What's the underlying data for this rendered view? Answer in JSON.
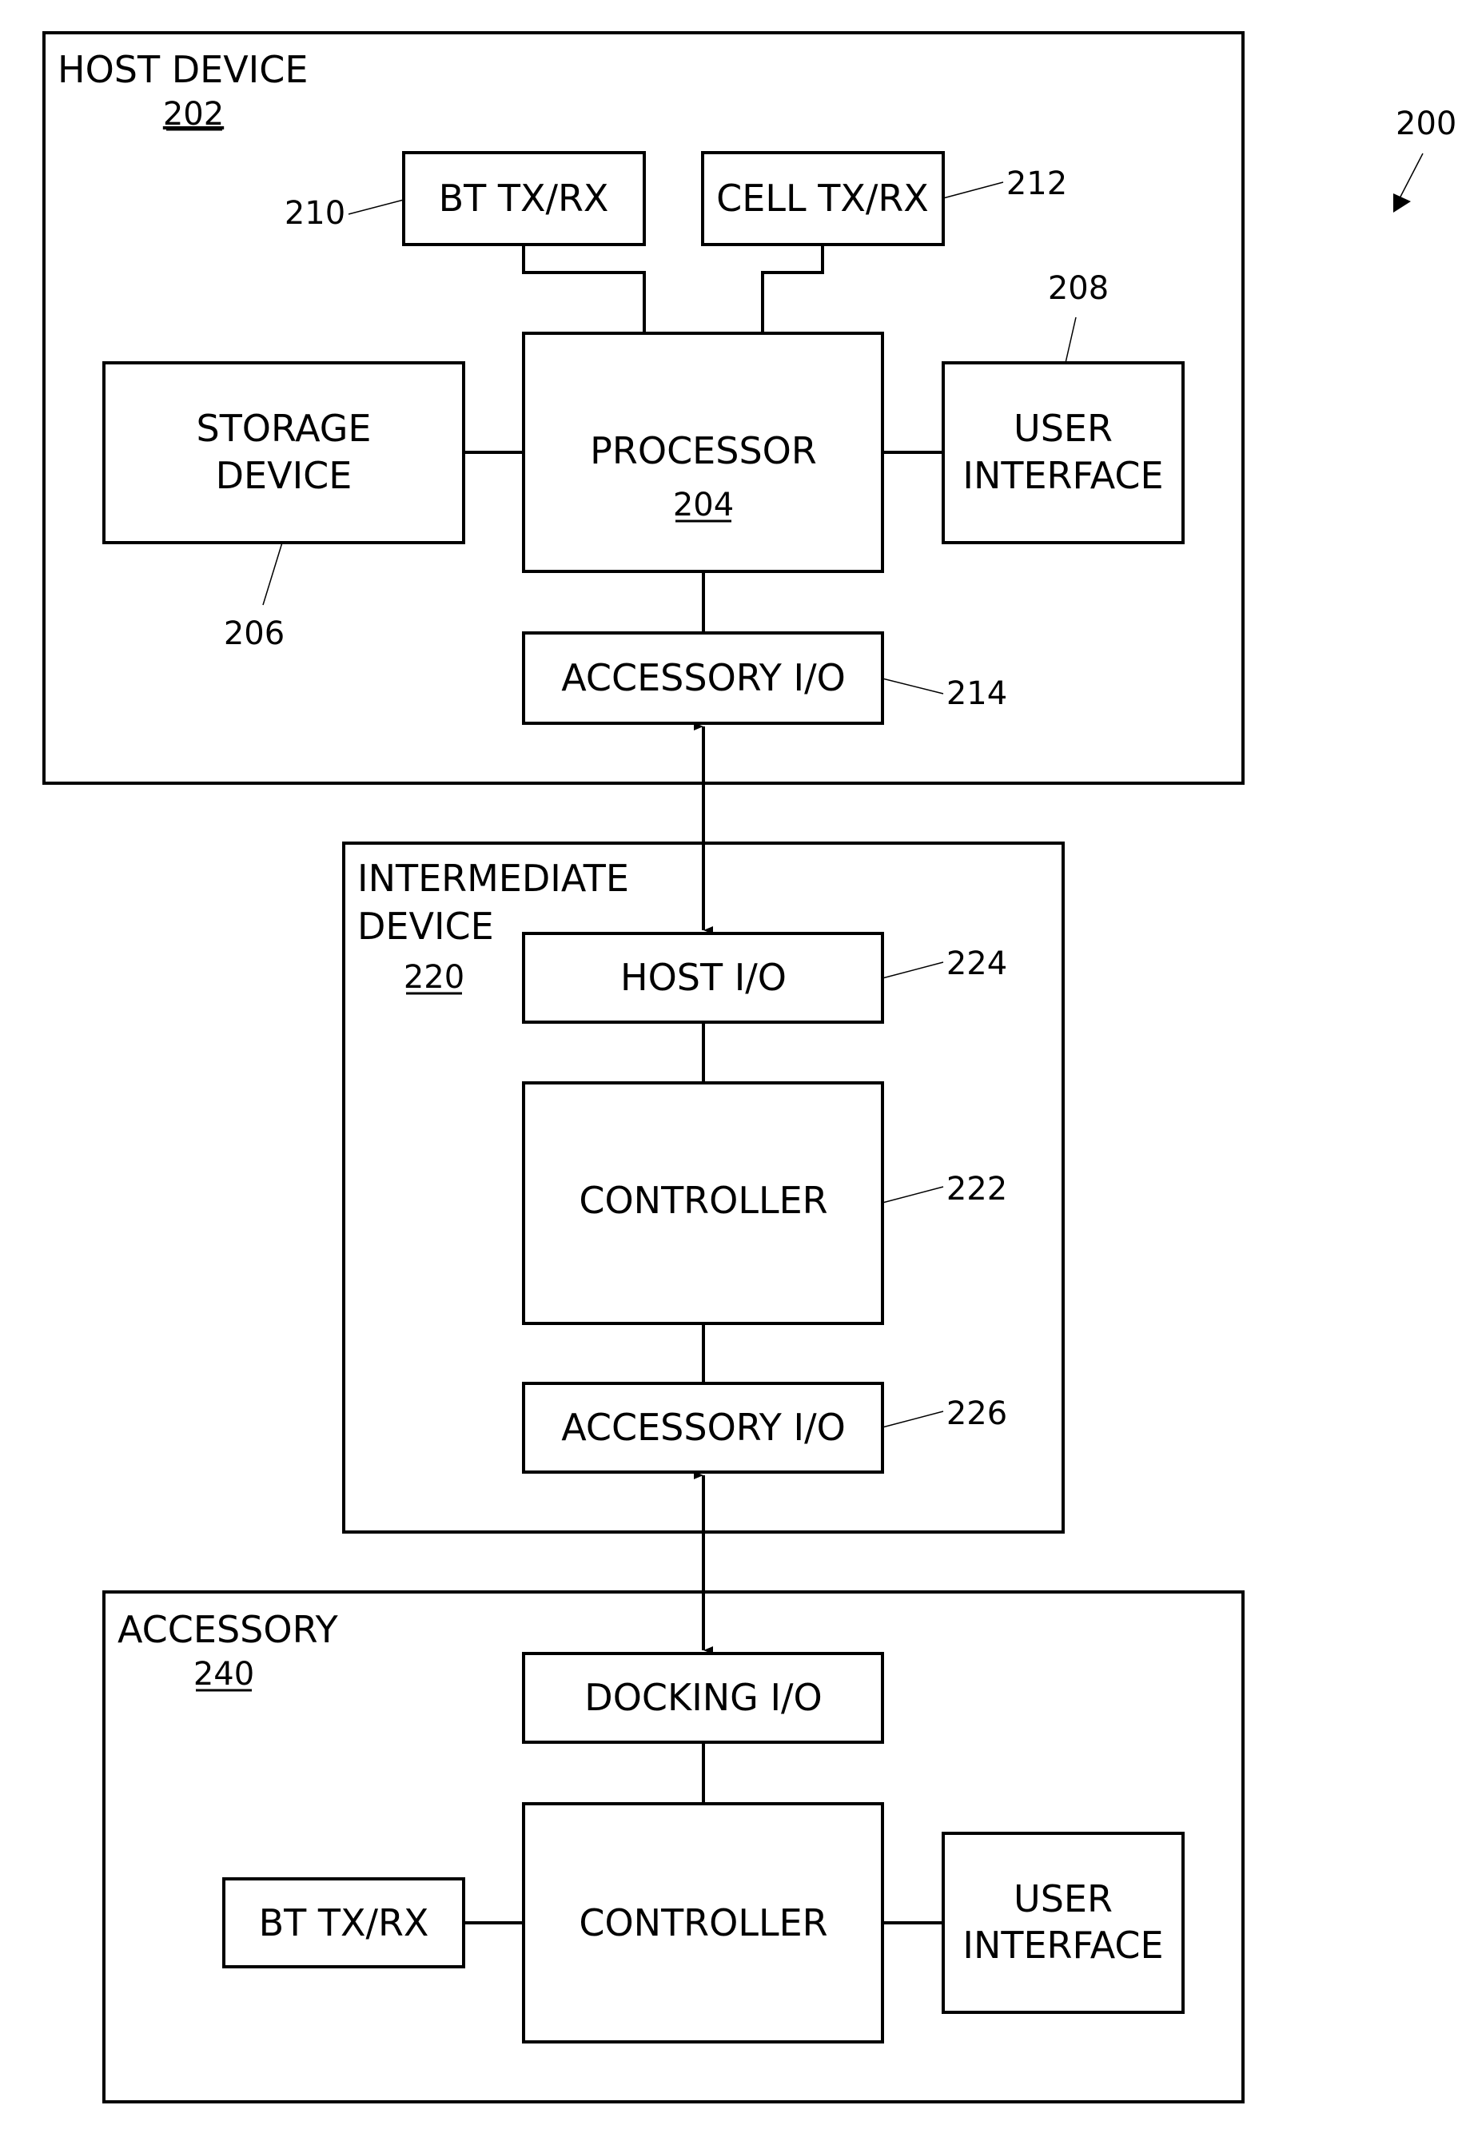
{
  "figure": {
    "ref": "200",
    "host": {
      "title": "HOST DEVICE",
      "ref": "202",
      "bt": {
        "label": "BT TX/RX",
        "ref": "210"
      },
      "cell": {
        "label": "CELL TX/RX",
        "ref": "212"
      },
      "storage": {
        "line1": "STORAGE",
        "line2": "DEVICE",
        "ref": "206"
      },
      "processor": {
        "label": "PROCESSOR",
        "ref": "204"
      },
      "ui": {
        "line1": "USER",
        "line2": "INTERFACE",
        "ref": "208"
      },
      "acc_io": {
        "label": "ACCESSORY I/O",
        "ref": "214"
      }
    },
    "intermediate": {
      "line1": "INTERMEDIATE",
      "line2": "DEVICE",
      "ref": "220",
      "host_io": {
        "label": "HOST I/O",
        "ref": "224"
      },
      "controller": {
        "label": "CONTROLLER",
        "ref": "222"
      },
      "acc_io": {
        "label": "ACCESSORY I/O",
        "ref": "226"
      }
    },
    "accessory": {
      "title": "ACCESSORY",
      "ref": "240",
      "docking_io": {
        "label": "DOCKING I/O"
      },
      "controller": {
        "label": "CONTROLLER"
      },
      "bt": {
        "label": "BT TX/RX"
      },
      "ui": {
        "line1": "USER",
        "line2": "INTERFACE"
      }
    }
  }
}
